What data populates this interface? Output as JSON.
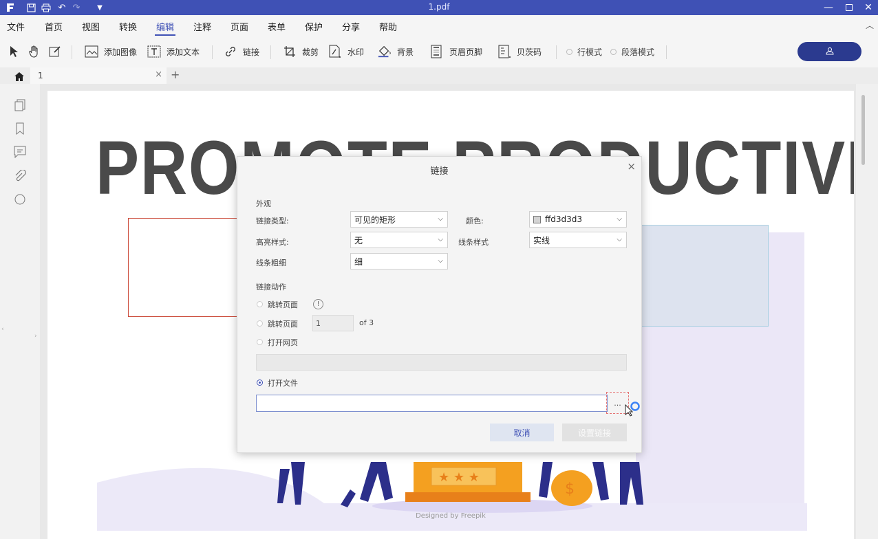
{
  "window": {
    "title": "1.pdf"
  },
  "menu": {
    "items": [
      "文件",
      "首页",
      "视图",
      "转换",
      "编辑",
      "注释",
      "页面",
      "表单",
      "保护",
      "分享",
      "帮助"
    ],
    "active": "编辑"
  },
  "toolbar": {
    "add_image": "添加图像",
    "add_text": "添加文本",
    "link": "链接",
    "crop": "裁剪",
    "watermark": "水印",
    "background": "背景",
    "header_footer": "页眉页脚",
    "bates": "贝茨码",
    "line_mode": "行模式",
    "paragraph_mode": "段落模式"
  },
  "tabs": {
    "doc_tab": "1"
  },
  "document": {
    "headline": "PROMOTE PRODUCTIVITY",
    "credit": "Designed by Freepik"
  },
  "dialog": {
    "title": "链接",
    "appearance_section": "外观",
    "link_type_label": "链接类型:",
    "link_type_value": "可见的矩形",
    "color_label": "颜色:",
    "color_value": "ffd3d3d3",
    "highlight_label": "高亮样式:",
    "highlight_value": "无",
    "line_style_label": "线条样式",
    "line_style_value": "实线",
    "line_width_label": "线条粗细",
    "line_width_value": "细",
    "action_section": "链接动作",
    "goto_page_label_1": "跳转页面",
    "goto_page_label_2": "跳转页面",
    "page_number": "1",
    "of_pages": "of 3",
    "open_web_label": "打开网页",
    "open_file_label": "打开文件",
    "browse_label": "...",
    "cancel_label": "取消",
    "set_link_label": "设置链接"
  },
  "colors": {
    "accent": "#3f51b5",
    "user_button": "#2b3a8f",
    "swatch": "#d3d3d3"
  }
}
